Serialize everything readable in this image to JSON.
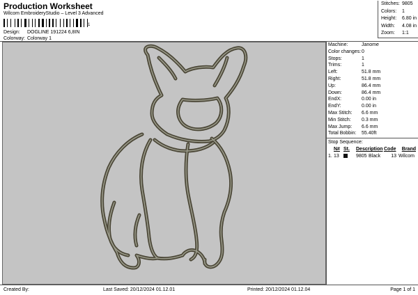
{
  "header": {
    "title": "Production Worksheet",
    "subtitle": "Wilcom EmbroideryStudio – Level 3 Advanced",
    "barcode_mark": "1"
  },
  "design": {
    "label": "Design:",
    "value": "DOGLINE 191224 6,8IN"
  },
  "colorway": {
    "label": "Colorway:",
    "value": "Colorway 1"
  },
  "stats": [
    {
      "k": "Stitches:",
      "v": "9805"
    },
    {
      "k": "Colors:",
      "v": "1"
    },
    {
      "k": "Height:",
      "v": "6.80 in"
    },
    {
      "k": "Width:",
      "v": "4.08 in"
    },
    {
      "k": "Zoom:",
      "v": "1:1"
    }
  ],
  "details": [
    {
      "k": "Machine:",
      "v": "Janome"
    },
    {
      "k": "Color changes:",
      "v": "0"
    },
    {
      "k": "Stops:",
      "v": "1"
    },
    {
      "k": "Trims:",
      "v": "1"
    },
    {
      "k": "Left:",
      "v": "51.8 mm"
    },
    {
      "k": "Right:",
      "v": "51.8 mm"
    },
    {
      "k": "Up:",
      "v": "86.4 mm"
    },
    {
      "k": "Down:",
      "v": "86.4 mm"
    },
    {
      "k": "EndX:",
      "v": "0.00 in"
    },
    {
      "k": "EndY:",
      "v": "0.00 in"
    },
    {
      "k": "Max Stitch:",
      "v": "6.6 mm"
    },
    {
      "k": "Min Stitch:",
      "v": "0.3 mm"
    },
    {
      "k": "Max Jump:",
      "v": "6.6 mm"
    },
    {
      "k": "Total Bobbin:",
      "v": "55.40ft"
    }
  ],
  "sequence": {
    "title": "Stop Sequence:",
    "headers": {
      "n": "N#",
      "st": "St.",
      "desc": "Description",
      "code": "Code",
      "brand": "Brand"
    },
    "row": {
      "idx": "1.",
      "n": "13",
      "st": "9805",
      "desc": "Black",
      "code": "13",
      "brand": "Wilcom"
    },
    "swatch_color": "#111111"
  },
  "footer": {
    "created": "Created By:",
    "saved": "Last Saved: 20/12/2024 01.12.01",
    "printed": "Printed: 20/12/2024 01.12.04",
    "page": "Page 1 of 1"
  },
  "colors": {
    "canvas_bg": "#c4c4c4",
    "stitch": "#4a4636"
  }
}
